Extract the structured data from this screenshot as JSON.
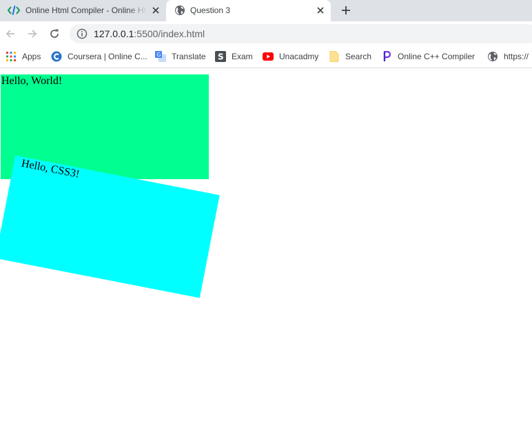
{
  "tabs": [
    {
      "title": "Online Html Compiler - Online Html Editor",
      "icon": "code-icon",
      "active": false
    },
    {
      "title": "Question 3",
      "icon": "globe-icon",
      "active": true
    }
  ],
  "toolbar": {
    "url_host": "127.0.0.1",
    "url_path": ":5500/index.html"
  },
  "bookmarks": [
    {
      "label": "Apps",
      "icon": "apps-grid-icon"
    },
    {
      "label": "Coursera | Online C...",
      "icon": "coursera-icon"
    },
    {
      "label": "Translate",
      "icon": "translate-icon"
    },
    {
      "label": "Exam",
      "icon": "exam-icon"
    },
    {
      "label": "Unacadmy",
      "icon": "youtube-icon"
    },
    {
      "label": "Search",
      "icon": "folder-icon"
    },
    {
      "label": "Online C++ Compiler",
      "icon": "programiz-icon"
    },
    {
      "label": "https://",
      "icon": "globe-icon"
    }
  ],
  "page": {
    "box1_text": "Hello, World!",
    "box2_text": "Hello, CSS3!"
  },
  "colors": {
    "tabstrip": "#dee1e6",
    "box1": "#00ff90",
    "box2": "#00ffff"
  }
}
